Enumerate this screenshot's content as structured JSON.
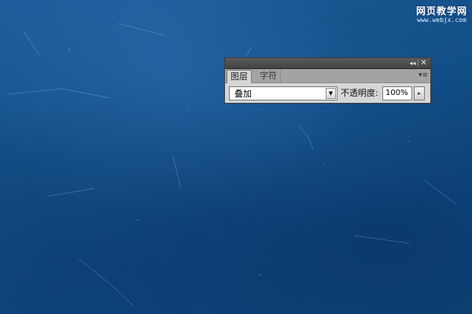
{
  "watermark": {
    "title": "网页教学网",
    "url": "www.webjx.com"
  },
  "panel": {
    "collapse_icon": "◂◂",
    "close_icon": "✕",
    "tabs": [
      {
        "label": "图层",
        "active": true
      },
      {
        "label": "字符",
        "active": false
      }
    ],
    "menu_icon": "▾≡",
    "blend_mode": {
      "selected": "叠加",
      "arrow": "▼"
    },
    "opacity": {
      "label": "不透明度:",
      "value": "100%",
      "arrow": "▸"
    }
  },
  "colors": {
    "background": "#145089",
    "panel_bg": "#d6d6d6",
    "titlebar": "#4a4a4a"
  }
}
